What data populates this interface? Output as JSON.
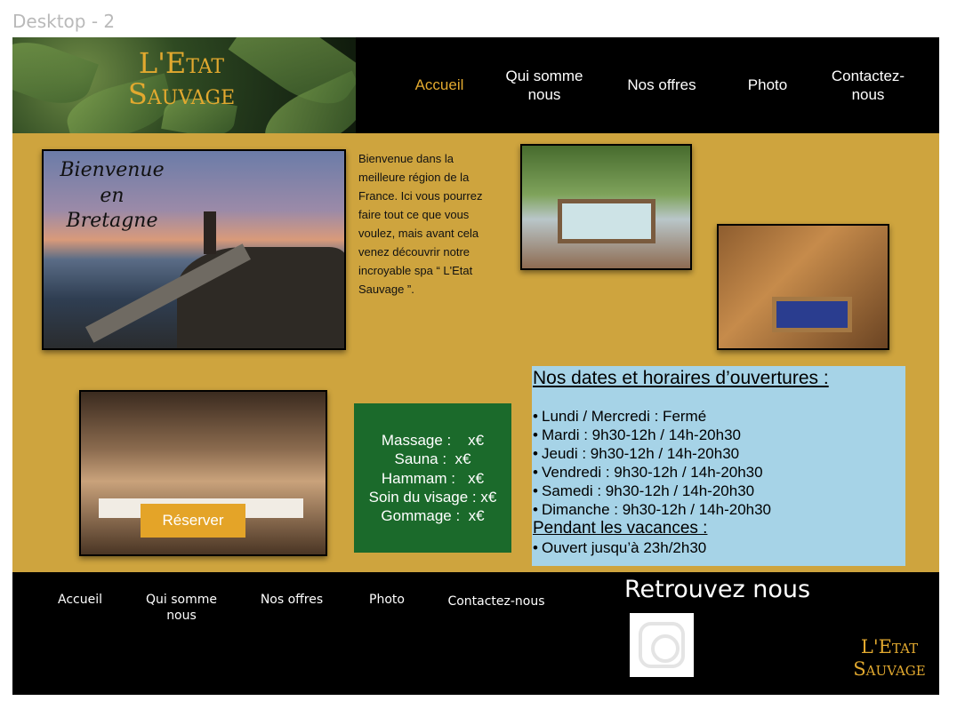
{
  "frame_label": "Desktop - 2",
  "brand": {
    "line1": "L'Etat",
    "line2": "Sauvage",
    "accent_color": "#e2a92f"
  },
  "nav": {
    "items": [
      {
        "label": "Accueil",
        "active": true
      },
      {
        "label": "Qui somme nous",
        "active": false
      },
      {
        "label": "Nos offres",
        "active": false
      },
      {
        "label": "Photo",
        "active": false
      },
      {
        "label": "Contactez-nous",
        "active": false
      }
    ]
  },
  "hero": {
    "overlay_line1": "Bienvenue",
    "overlay_line2": "en",
    "overlay_line3": "Bretagne",
    "intro_text": "Bienvenue dans la meilleure région de la France. Ici vous pourrez faire tout ce que vous voulez, mais avant cela venez découvrir notre incroyable spa “ L'Etat Sauvage ”."
  },
  "reserve_button": "Réserver",
  "prices": {
    "rows": [
      "Massage :    x€",
      "Sauna :  x€",
      "Hammam :   x€",
      "Soin du visage : x€",
      "Gommage :  x€"
    ],
    "background": "#1b6a2b"
  },
  "hours": {
    "title": "Nos dates et horaires d’ouvertures :",
    "days": [
      "Lundi / Mercredi : Fermé",
      "Mardi : 9h30-12h / 14h-20h30",
      "Jeudi : 9h30-12h / 14h-20h30",
      "Vendredi : 9h30-12h / 14h-20h30",
      "Samedi : 9h30-12h / 14h-20h30",
      "Dimanche : 9h30-12h / 14h-20h30"
    ],
    "vacation_title": "Pendant les vacances :",
    "vacation_items": [
      "Ouvert jusqu’à 23h/2h30"
    ],
    "background": "#a6d3e7"
  },
  "footer": {
    "nav": [
      "Accueil",
      "Qui somme nous",
      "Nos offres",
      "Photo",
      "Contactez-nous"
    ],
    "find_us": "Retrouvez nous",
    "social_icon": "instagram-icon"
  },
  "colors": {
    "main_bg": "#cea43e",
    "header_bg": "#000000",
    "button_bg": "#e4a428"
  }
}
